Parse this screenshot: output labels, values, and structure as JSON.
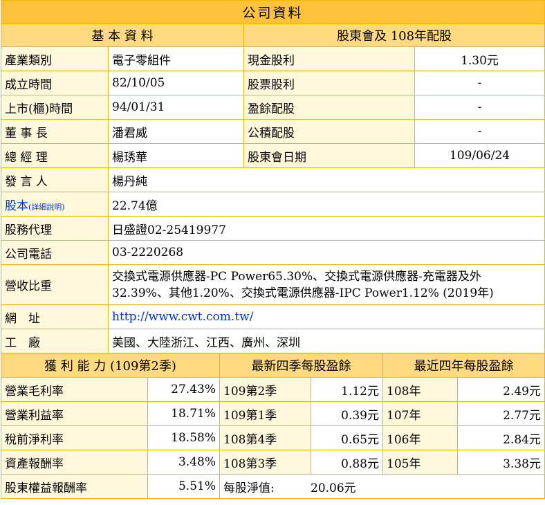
{
  "title": "公司資料",
  "basic": {
    "header": "基 本 資 料",
    "rows": [
      {
        "label": "產業類別",
        "value": "電子零組件"
      },
      {
        "label": "成立時間",
        "value": "82/10/05"
      },
      {
        "label": "上市(櫃)時間",
        "value": "94/01/31"
      },
      {
        "label": "董 事 長",
        "value": "潘君威"
      },
      {
        "label": "總 經 理",
        "value": "楊琇華"
      }
    ],
    "spokesperson_label": "發 言 人",
    "spokesperson": "楊丹純",
    "capital_label": "股本",
    "capital_note": "(詳細說明)",
    "capital": "22.74億",
    "agent_label": "股務代理",
    "agent": "日盛證02-25419977",
    "phone_label": "公司電話",
    "phone": "03-2220268",
    "revenue_label": "營收比重",
    "revenue_line1": "交換式電源供應器-PC Power65.30%、交換式電源供應器-充電器及外",
    "revenue_line2": "32.39%、其他1.20%、交換式電源供應器-IPC Power1.12% (2019年)",
    "website_label": "網　址",
    "website": "http://www.cwt.com.tw/",
    "factory_label": "工　廠",
    "factory": "美國、大陸浙江、江西、廣州、深圳"
  },
  "dividend": {
    "header": "股東會及 108年配股",
    "rows": [
      {
        "label": "現金股利",
        "value": "1.30元"
      },
      {
        "label": "股票股利",
        "value": "-"
      },
      {
        "label": "盈餘配股",
        "value": "-"
      },
      {
        "label": "公積配股",
        "value": "-"
      },
      {
        "label": "股東會日期",
        "value": "109/06/24"
      }
    ]
  },
  "profit": {
    "header": "獲 利 能 力 (109第2季)",
    "rows": [
      {
        "label": "營業毛利率",
        "value": "27.43%"
      },
      {
        "label": "營業利益率",
        "value": "18.71%"
      },
      {
        "label": "稅前淨利率",
        "value": "18.58%"
      },
      {
        "label": "資產報酬率",
        "value": "3.48%"
      },
      {
        "label": "股東權益報酬率",
        "value": "5.51%"
      }
    ]
  },
  "eps_quarters": {
    "header": "最新四季每股盈餘",
    "rows": [
      {
        "label": "109第2季",
        "value": "1.12元"
      },
      {
        "label": "109第1季",
        "value": "0.39元"
      },
      {
        "label": "108第4季",
        "value": "0.65元"
      },
      {
        "label": "108第3季",
        "value": "0.88元"
      }
    ],
    "nav_label": "每股淨值:",
    "nav_value": "20.06元"
  },
  "eps_years": {
    "header": "最近四年每股盈餘",
    "rows": [
      {
        "label": "108年",
        "value": "2.49元"
      },
      {
        "label": "107年",
        "value": "2.77元"
      },
      {
        "label": "106年",
        "value": "2.84元"
      },
      {
        "label": "105年",
        "value": "3.38元"
      }
    ]
  }
}
